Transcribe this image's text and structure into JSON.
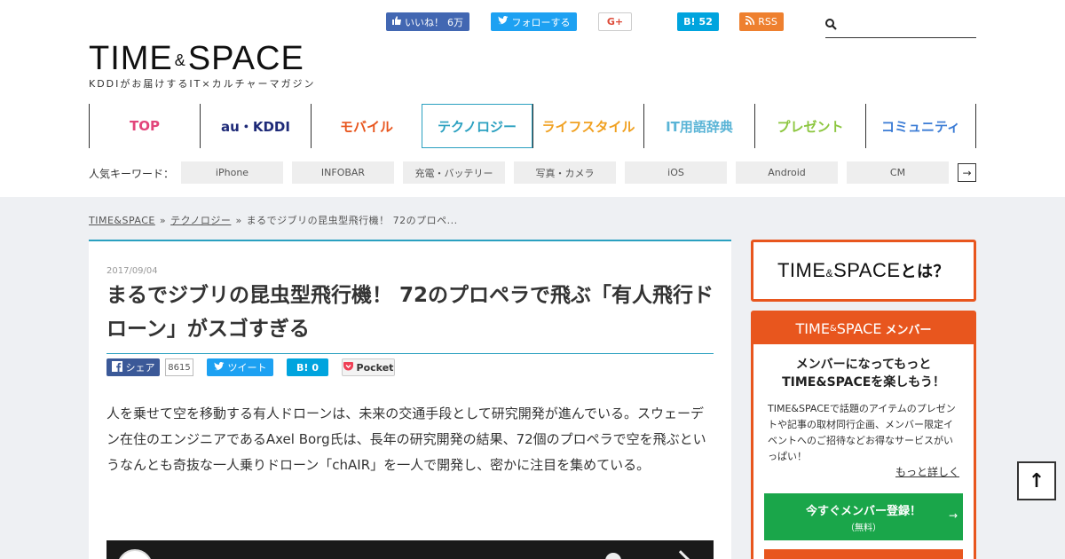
{
  "header": {
    "logo_main_left": "TIME",
    "logo_amp": "&",
    "logo_main_right": "SPACE",
    "logo_sub": "KDDIがお届けするIT×カルチャーマガジン",
    "social": {
      "fb_like_label": "いいね！",
      "fb_like_count": "6万",
      "tw_follow_label": "フォローする",
      "gplus_label": "G+",
      "hatena_label": "B!",
      "hatena_count": "52",
      "rss_label": "RSS"
    },
    "search": {
      "placeholder": ""
    },
    "nav": [
      {
        "label": "TOP",
        "color": "#e2457b"
      },
      {
        "label": "au・KDDI",
        "color": "#1e2a78"
      },
      {
        "label": "モバイル",
        "color": "#e8561e"
      },
      {
        "label": "テクノロジー",
        "color": "#2aa0c0"
      },
      {
        "label": "ライフスタイル",
        "color": "#f0a020"
      },
      {
        "label": "IT用語辞典",
        "color": "#5ab4d6"
      },
      {
        "label": "プレゼント",
        "color": "#8cc63f"
      },
      {
        "label": "コミュニティ",
        "color": "#3a7bd5"
      }
    ],
    "keywords_label": "人気キーワード：",
    "keywords": [
      "iPhone",
      "INFOBAR",
      "充電・バッテリー",
      "写真・カメラ",
      "iOS",
      "Android",
      "CM"
    ],
    "keywords_next": "→"
  },
  "breadcrumb": {
    "home": "TIME&SPACE",
    "category": "テクノロジー",
    "current": "まるでジブリの昆虫型飛行機！ 72のプロペ...",
    "separator": "»"
  },
  "article": {
    "date": "2017/09/04",
    "title": "まるでジブリの昆虫型飛行機！ 72のプロペラで飛ぶ「有人飛行ドローン」がスゴすぎる",
    "share": {
      "fb_label": "シェア",
      "fb_count": "8615",
      "tw_label": "ツイート",
      "hatena_label": "B!",
      "hatena_count": "0",
      "pocket_label": "Pocket"
    },
    "body": "人を乗せて空を移動する有人ドローンは、未来の交通手段として研究開発が進んでいる。スウェーデン在住のエンジニアであるAxel Borg氏は、長年の研究開発の結果、72個のプロペラで空を飛ぶというなんとも奇抜な一人乗りドローン「chAIR」を一人で開発し、密かに注目を集めている。"
  },
  "sidebar": {
    "about_left": "TIME",
    "about_amp": "&",
    "about_right": "SPACE",
    "about_suffix": "とは？",
    "member_head_left": "TIME",
    "member_head_amp": "&",
    "member_head_right": "SPACE",
    "member_head_suffix": "メンバー",
    "member_lead_1": "メンバーになってもっと",
    "member_lead_2": "TIME&SPACEを楽しもう！",
    "member_desc": "TIME&SPACEで話題のアイテムのプレゼントや記事の取材同行企画、メンバー限定イベントへのご招待などお得なサービスがいっぱい！",
    "member_more": "もっと詳しく",
    "cta_label": "今すぐメンバー登録！",
    "cta_sub": "（無料）",
    "cta_arrow": "→"
  },
  "to_top": "↑",
  "colors": {
    "accent": "#2aa0c0",
    "orange": "#e8561e",
    "green": "#1aa64a",
    "content_bg": "#eef0f3"
  }
}
